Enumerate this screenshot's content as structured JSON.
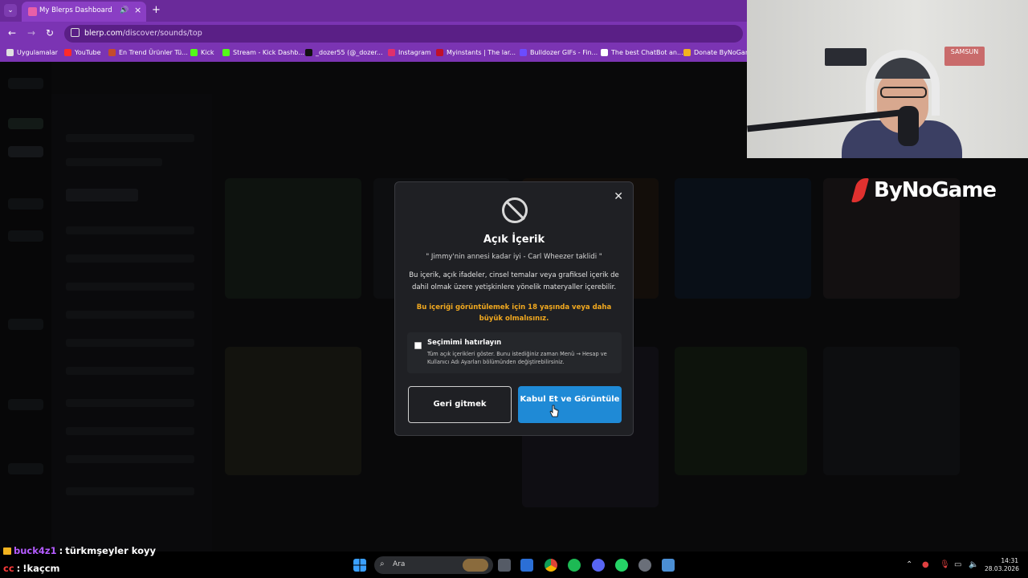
{
  "browser": {
    "tab_title": "My Blerps Dashboard",
    "url_host": "blerp.com",
    "url_path": "/discover/sounds/top",
    "bookmarks": [
      {
        "label": "Uygulamalar",
        "icon": "apps-grid-icon",
        "color": "#e0e0e0"
      },
      {
        "label": "YouTube",
        "icon": "youtube-icon",
        "color": "#ff2a2a"
      },
      {
        "label": "En Trend Ürünler Tü...",
        "icon": "globe-icon",
        "color": "#c44c2c"
      },
      {
        "label": "Kick",
        "icon": "kick-icon",
        "color": "#53fc18"
      },
      {
        "label": "Stream - Kick Dashb...",
        "icon": "kick-icon",
        "color": "#53fc18"
      },
      {
        "label": "_dozer55 (@_dozer...",
        "icon": "tiktok-icon",
        "color": "#111111"
      },
      {
        "label": "Instagram",
        "icon": "instagram-icon",
        "color": "#e1306c"
      },
      {
        "label": "Myinstants | The lar...",
        "icon": "myinstants-icon",
        "color": "#c0102a"
      },
      {
        "label": "Bulldozer GIFs - Fin...",
        "icon": "giphy-icon",
        "color": "#6b4cff"
      },
      {
        "label": "The best ChatBot an...",
        "icon": "chatbot-icon",
        "color": "#ffffff"
      },
      {
        "label": "Donate ByNoGam",
        "icon": "donate-icon",
        "color": "#f2b31f"
      }
    ]
  },
  "brand": {
    "logo_text": "ByNoGame",
    "webcam_sign_right": "SAMSUN"
  },
  "modal": {
    "title": "Açık İçerik",
    "quote": "\" Jimmy'nin annesi kadar iyi - Carl Wheezer taklidi \"",
    "description": "Bu içerik, açık ifadeler, cinsel temalar veya grafiksel içerik de dahil olmak üzere yetişkinlere yönelik materyaller içerebilir.",
    "age_warning": "Bu içeriği görüntülemek için 18 yaşında veya daha büyük olmalısınız.",
    "remember_label": "Seçimimi hatırlayın",
    "remember_checked": false,
    "remember_description": "Tüm açık içerikleri göster. Bunu istediğiniz zaman Menü → Hesap ve Kullanıcı Adı Ayarları bölümünden değiştirebilirsiniz.",
    "back_button": "Geri gitmek",
    "accept_button": "Kabul Et ve Görüntüle",
    "close_glyph": "✕"
  },
  "chat": [
    {
      "user": "buck4z1",
      "separator": ":",
      "message": "türkmşeyler koyy",
      "user_color": "#b45bff"
    },
    {
      "user": "cc",
      "separator": ":",
      "message": "!kaçcm",
      "user_color": "#ff3b3b"
    }
  ],
  "taskbar": {
    "search_placeholder": "Ara",
    "time": "14:31",
    "date": "28.03.2026"
  },
  "colors": {
    "accent_blue": "#1f8ad6",
    "warning_orange": "#f2a91f",
    "browser_purple": "#7b34b3",
    "modal_bg": "#1f2024"
  }
}
